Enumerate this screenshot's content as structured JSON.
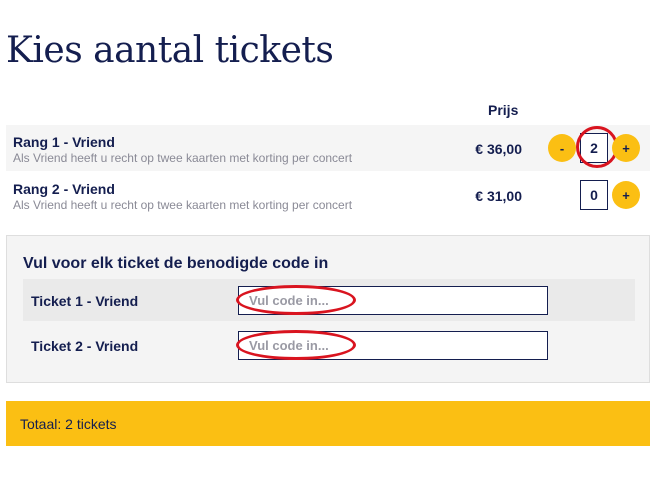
{
  "page": {
    "title": "Kies aantal tickets",
    "price_header": "Prijs"
  },
  "tiers": [
    {
      "name": "Rang 1 - Vriend",
      "description": "Als Vriend heeft u recht op twee kaarten met korting per concert",
      "price": "€ 36,00",
      "quantity": "2",
      "minus_label": "-",
      "plus_label": "+"
    },
    {
      "name": "Rang 2 - Vriend",
      "description": "Als Vriend heeft u recht op twee kaarten met korting per concert",
      "price": "€ 31,00",
      "quantity": "0",
      "plus_label": "+"
    }
  ],
  "codes": {
    "heading": "Vul voor elk ticket de benodigde code in",
    "rows": [
      {
        "label": "Ticket 1 - Vriend",
        "placeholder": "Vul code in...",
        "value": ""
      },
      {
        "label": "Ticket 2 - Vriend",
        "placeholder": "Vul code in...",
        "value": ""
      }
    ]
  },
  "summary": {
    "total": "Totaal: 2 tickets"
  },
  "colors": {
    "accent": "#fbbf13",
    "text": "#141e4f",
    "annotation": "#d9141f",
    "muted": "#8a8a96"
  },
  "icons": {
    "minus": "minus-icon",
    "plus": "plus-icon"
  }
}
